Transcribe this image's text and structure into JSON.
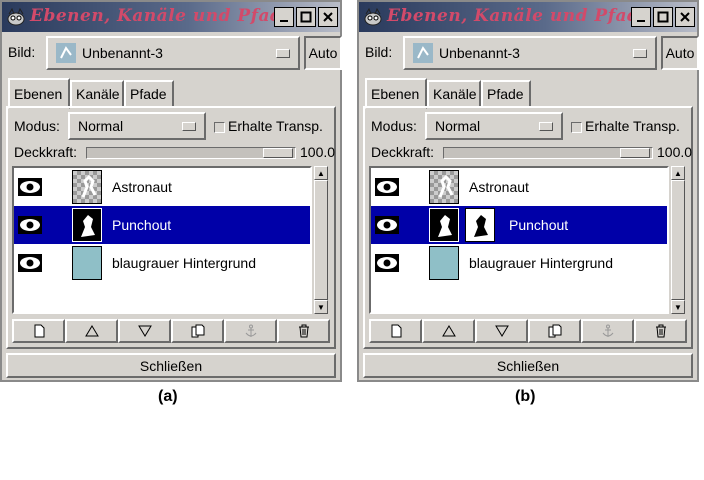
{
  "panels": [
    {
      "title": "Ebenen, Kanäle und Pfade",
      "image_label": "Bild:",
      "image_value": "Unbenannt-3",
      "auto_label": "Auto",
      "tabs": [
        "Ebenen",
        "Kanäle",
        "Pfade"
      ],
      "active_tab": "Ebenen",
      "mode_label": "Modus:",
      "mode_value": "Normal",
      "preserve_label": "Erhalte Transp.",
      "opacity_label": "Deckkraft:",
      "opacity_value": "100.0",
      "layers": [
        {
          "name": "Astronaut",
          "selected": false,
          "thumb": "checker"
        },
        {
          "name": "Punchout",
          "selected": true,
          "thumb": "figure"
        },
        {
          "name": "blaugrauer Hintergrund",
          "selected": false,
          "thumb": "bluegray"
        }
      ],
      "close_label": "Schließen",
      "caption": "(a)"
    },
    {
      "title": "Ebenen, Kanäle und Pfade",
      "image_label": "Bild:",
      "image_value": "Unbenannt-3",
      "auto_label": "Auto",
      "tabs": [
        "Ebenen",
        "Kanäle",
        "Pfade"
      ],
      "active_tab": "Ebenen",
      "mode_label": "Modus:",
      "mode_value": "Normal",
      "preserve_label": "Erhalte Transp.",
      "opacity_label": "Deckkraft:",
      "opacity_value": "100.0",
      "layers": [
        {
          "name": "Astronaut",
          "selected": false,
          "thumb": "checker"
        },
        {
          "name": "Punchout",
          "selected": true,
          "thumb": "figure",
          "mask": true
        },
        {
          "name": "blaugrauer Hintergrund",
          "selected": false,
          "thumb": "bluegray"
        }
      ],
      "close_label": "Schließen",
      "caption": "(b)"
    }
  ],
  "icons": {
    "window_menu": "wilber-icon",
    "minimize": "minimize-icon",
    "maximize": "maximize-icon",
    "close": "close-icon",
    "actions": [
      "new-layer-icon",
      "raise-layer-icon",
      "lower-layer-icon",
      "duplicate-layer-icon",
      "anchor-icon",
      "trash-icon"
    ]
  },
  "colors": {
    "selection": "#0000a8",
    "panel": "#d6d3ce",
    "title_text": "#d24a6a",
    "bluegray_layer": "#8fbfc7"
  }
}
